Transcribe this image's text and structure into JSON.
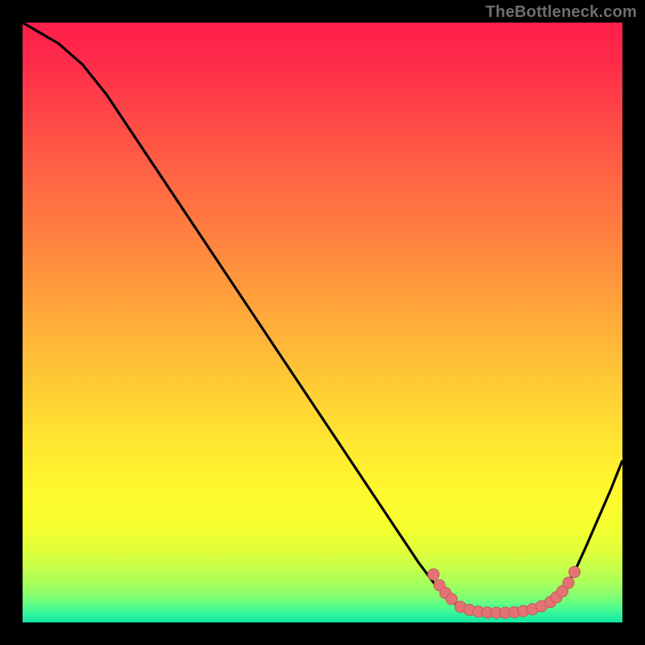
{
  "attribution": "TheBottleneck.com",
  "colors": {
    "page_bg": "#000000",
    "curve": "#000000",
    "marker_fill": "#e57373",
    "marker_stroke": "#c55a5a",
    "gradient_stops": [
      {
        "offset": 0.0,
        "color": "#ff1f4b"
      },
      {
        "offset": 0.06,
        "color": "#ff2a4a"
      },
      {
        "offset": 0.14,
        "color": "#ff4348"
      },
      {
        "offset": 0.22,
        "color": "#ff5a45"
      },
      {
        "offset": 0.3,
        "color": "#ff7142"
      },
      {
        "offset": 0.38,
        "color": "#ff883f"
      },
      {
        "offset": 0.46,
        "color": "#ffa03b"
      },
      {
        "offset": 0.54,
        "color": "#ffb838"
      },
      {
        "offset": 0.62,
        "color": "#ffd034"
      },
      {
        "offset": 0.7,
        "color": "#ffe631"
      },
      {
        "offset": 0.78,
        "color": "#fff82e"
      },
      {
        "offset": 0.84,
        "color": "#f6ff2e"
      },
      {
        "offset": 0.88,
        "color": "#e0ff3a"
      },
      {
        "offset": 0.91,
        "color": "#c5ff4a"
      },
      {
        "offset": 0.935,
        "color": "#a7ff5c"
      },
      {
        "offset": 0.955,
        "color": "#86ff70"
      },
      {
        "offset": 0.97,
        "color": "#5fff86"
      },
      {
        "offset": 0.985,
        "color": "#34f59a"
      },
      {
        "offset": 1.0,
        "color": "#12e6a4"
      }
    ]
  },
  "chart_data": {
    "type": "line",
    "title": "",
    "xlabel": "",
    "ylabel": "",
    "xlim": [
      0,
      100
    ],
    "ylim": [
      0,
      100
    ],
    "curve": [
      {
        "x": 0,
        "y": 100
      },
      {
        "x": 6,
        "y": 96.5
      },
      {
        "x": 10,
        "y": 93
      },
      {
        "x": 14,
        "y": 88
      },
      {
        "x": 20,
        "y": 79
      },
      {
        "x": 26,
        "y": 70
      },
      {
        "x": 32,
        "y": 61
      },
      {
        "x": 38,
        "y": 52
      },
      {
        "x": 44,
        "y": 43
      },
      {
        "x": 50,
        "y": 34
      },
      {
        "x": 56,
        "y": 25
      },
      {
        "x": 62,
        "y": 16
      },
      {
        "x": 66,
        "y": 10
      },
      {
        "x": 69,
        "y": 6
      },
      {
        "x": 72,
        "y": 3.2
      },
      {
        "x": 74,
        "y": 2.2
      },
      {
        "x": 76,
        "y": 1.8
      },
      {
        "x": 78,
        "y": 1.6
      },
      {
        "x": 80,
        "y": 1.6
      },
      {
        "x": 82,
        "y": 1.7
      },
      {
        "x": 84,
        "y": 2.0
      },
      {
        "x": 86,
        "y": 2.5
      },
      {
        "x": 88,
        "y": 3.4
      },
      {
        "x": 90,
        "y": 5.2
      },
      {
        "x": 92,
        "y": 8.4
      },
      {
        "x": 94,
        "y": 12.8
      },
      {
        "x": 96,
        "y": 17.4
      },
      {
        "x": 98,
        "y": 22.0
      },
      {
        "x": 100,
        "y": 27.0
      }
    ],
    "markers": [
      {
        "x": 68.5,
        "y": 8.0
      },
      {
        "x": 69.5,
        "y": 6.2
      },
      {
        "x": 70.5,
        "y": 4.9
      },
      {
        "x": 71.5,
        "y": 3.9
      },
      {
        "x": 73.0,
        "y": 2.6
      },
      {
        "x": 74.5,
        "y": 2.1
      },
      {
        "x": 76.0,
        "y": 1.8
      },
      {
        "x": 77.5,
        "y": 1.65
      },
      {
        "x": 79.0,
        "y": 1.6
      },
      {
        "x": 80.5,
        "y": 1.62
      },
      {
        "x": 82.0,
        "y": 1.7
      },
      {
        "x": 83.5,
        "y": 1.9
      },
      {
        "x": 85.0,
        "y": 2.2
      },
      {
        "x": 86.5,
        "y": 2.7
      },
      {
        "x": 88.0,
        "y": 3.4
      },
      {
        "x": 89.0,
        "y": 4.2
      },
      {
        "x": 90.0,
        "y": 5.2
      },
      {
        "x": 91.0,
        "y": 6.6
      },
      {
        "x": 92.0,
        "y": 8.4
      }
    ],
    "marker_r_px": 7
  }
}
